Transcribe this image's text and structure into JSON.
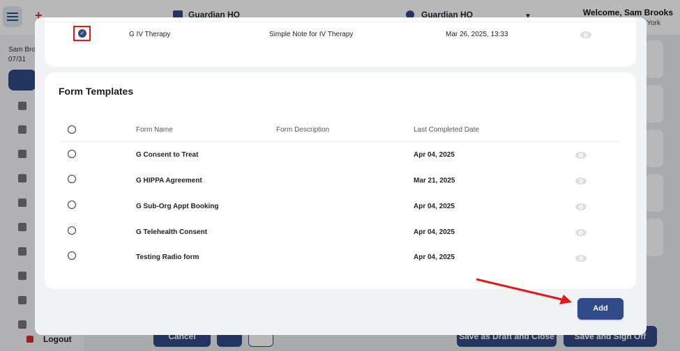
{
  "background": {
    "org_name": "Guardian HQ",
    "location_name": "Guardian HQ",
    "welcome": "Welcome, Sam Brooks",
    "welcome_sub": "York",
    "sidebar_user": "Sam Broo",
    "sidebar_date": "07/31",
    "logout_label": "Logout",
    "bottom_buttons": [
      "Cancel",
      "Save as Draft and Close",
      "Save and Sign Off"
    ]
  },
  "notes_selected_row": {
    "name": "G IV Therapy",
    "description": "Simple Note for IV Therapy",
    "date": "Mar 26, 2025, 13:33"
  },
  "form_templates": {
    "title": "Form Templates",
    "columns": [
      "Form Name",
      "Form Description",
      "Last Completed Date"
    ],
    "rows": [
      {
        "name": "G Consent to Treat",
        "description": "",
        "date": "Apr 04, 2025"
      },
      {
        "name": "G HIPPA Agreement",
        "description": "",
        "date": "Mar 21, 2025"
      },
      {
        "name": "G Sub-Org Appt Booking",
        "description": "",
        "date": "Apr 04, 2025"
      },
      {
        "name": "G Telehealth Consent",
        "description": "",
        "date": "Apr 04, 2025"
      },
      {
        "name": "Testing Radio form",
        "description": "",
        "date": "Apr 04, 2025"
      }
    ]
  },
  "actions": {
    "add_label": "Add"
  },
  "colors": {
    "primary": "#2f4a86",
    "highlight": "#e11919",
    "brand": "#d32f2f"
  },
  "icons": [
    "hamburger-icon",
    "building-icon",
    "location-pin-icon",
    "check-icon",
    "eye-icon",
    "logout-icon"
  ]
}
